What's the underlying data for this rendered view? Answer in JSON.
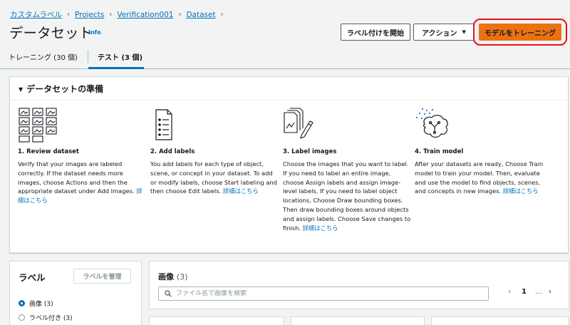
{
  "breadcrumb": [
    "カスタムラベル",
    "Projects",
    "Verification001",
    "Dataset"
  ],
  "page_title": "データセット",
  "info_label": "Info",
  "header_buttons": {
    "start_labeling": "ラベル付けを開始",
    "actions": "アクション",
    "train_model": "モデルをトレーニング"
  },
  "tabs": [
    {
      "label": "トレーニング (30 個)",
      "active": false
    },
    {
      "label": "テスト (3 個)",
      "active": true
    }
  ],
  "dataset_prep": {
    "title": "データセットの準備",
    "steps": [
      {
        "icon": "image-grid-icon",
        "title": "1. Review dataset",
        "description": "Verify that your images are labeled correctly. If the dataset needs more images, choose Actions and then the appropriate dataset under Add Images.",
        "link": "詳細はこちら"
      },
      {
        "icon": "document-list-icon",
        "title": "2. Add labels",
        "description": "You add labels for each type of object, scene, or concept in your dataset. To add or modify labels, choose Start labeling and then choose Edit labels.",
        "link": "詳細はこちら"
      },
      {
        "icon": "label-images-icon",
        "title": "3. Label images",
        "description": "Choose the images that you want to label. If you need to label an entire image, choose Assign labels and assign image-level labels. If you need to label object locations, Choose Draw bounding boxes. Then draw bounding boxes around objects and assign labels. Choose Save changes to finish.",
        "link": "詳細はこちら"
      },
      {
        "icon": "brain-model-icon",
        "title": "4. Train model",
        "description": "After your datasets are ready, Choose Train model to train your model. Then, evaluate and use the model to find objects, scenes, and concepts in new images.",
        "link": "詳細はこちら"
      }
    ]
  },
  "labels_panel": {
    "title": "ラベル",
    "manage_button": "ラベルを管理",
    "filters": [
      {
        "label": "画像 (3)",
        "checked": true
      },
      {
        "label": "ラベル付き (3)",
        "checked": false
      }
    ]
  },
  "images_panel": {
    "title": "画像",
    "count": "(3)",
    "search_placeholder": "ファイル名で画像を検索",
    "pagination": {
      "prev": "‹",
      "page": "1",
      "ellipsis": "...",
      "next": "›"
    }
  },
  "colors": {
    "accent": "#0073bb",
    "primary_button": "#ec7211",
    "highlight": "#e8101a"
  }
}
